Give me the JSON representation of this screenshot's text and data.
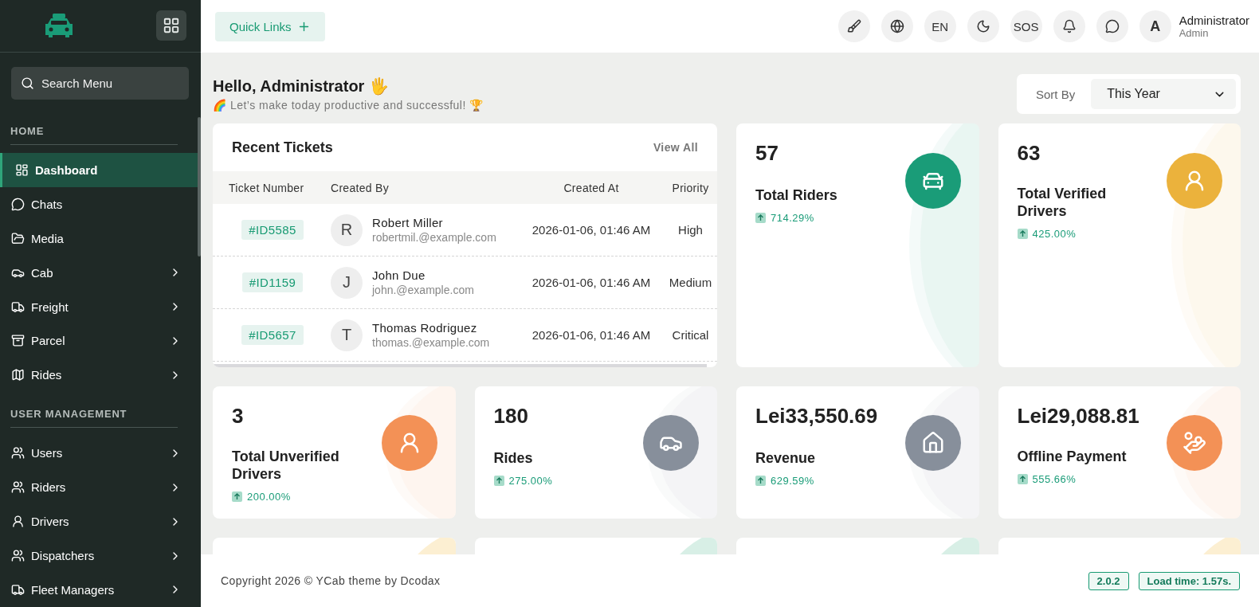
{
  "sidebar": {
    "search": {
      "placeholder": "Search Menu"
    },
    "sections": [
      {
        "title": "HOME",
        "items": [
          {
            "label": "Dashboard",
            "selected": true,
            "expandable": false
          },
          {
            "label": "Chats",
            "selected": false,
            "expandable": false
          },
          {
            "label": "Media",
            "selected": false,
            "expandable": false
          },
          {
            "label": "Cab",
            "selected": false,
            "expandable": true
          },
          {
            "label": "Freight",
            "selected": false,
            "expandable": true
          },
          {
            "label": "Parcel",
            "selected": false,
            "expandable": true
          },
          {
            "label": "Rides",
            "selected": false,
            "expandable": true
          }
        ]
      },
      {
        "title": "USER MANAGEMENT",
        "items": [
          {
            "label": "Users",
            "selected": false,
            "expandable": true
          },
          {
            "label": "Riders",
            "selected": false,
            "expandable": true
          },
          {
            "label": "Drivers",
            "selected": false,
            "expandable": true
          },
          {
            "label": "Dispatchers",
            "selected": false,
            "expandable": true
          },
          {
            "label": "Fleet Managers",
            "selected": false,
            "expandable": true
          }
        ]
      }
    ]
  },
  "header": {
    "quick_links": "Quick Links",
    "language": "EN",
    "sos": "SOS",
    "user": {
      "initial": "A",
      "name": "Administrator",
      "role": "Admin"
    }
  },
  "greeting": {
    "title": "Hello, Administrator 🖐",
    "subtitle": "🌈 Let’s make today productive and successful! 🏆"
  },
  "sort": {
    "label": "Sort By",
    "value": "This Year"
  },
  "recent_tickets": {
    "title": "Recent Tickets",
    "view_all": "View All",
    "columns": [
      "Ticket Number",
      "Created By",
      "Created At",
      "Priority"
    ],
    "rows": [
      {
        "ticket": "#ID5585",
        "initial": "R",
        "name": "Robert Miller",
        "email": "robertmil.@example.com",
        "created_at": "2026-01-06, 01:46 AM",
        "priority": "High"
      },
      {
        "ticket": "#ID1159",
        "initial": "J",
        "name": "John Due",
        "email": "john.@example.com",
        "created_at": "2026-01-06, 01:46 AM",
        "priority": "Medium"
      },
      {
        "ticket": "#ID5657",
        "initial": "T",
        "name": "Thomas Rodriguez",
        "email": "thomas.@example.com",
        "created_at": "2026-01-06, 01:46 AM",
        "priority": "Critical"
      }
    ]
  },
  "stats": [
    {
      "value": "57",
      "label": "Total Riders",
      "change": "714.29%",
      "color": "#1a9c78"
    },
    {
      "value": "63",
      "label": "Total Verified Drivers",
      "change": "425.00%",
      "color": "#ebb23c"
    },
    {
      "value": "3",
      "label": "Total Unverified Drivers",
      "change": "200.00%",
      "color": "#f39156"
    },
    {
      "value": "180",
      "label": "Rides",
      "change": "275.00%",
      "color": "#878f9b"
    },
    {
      "value": "Lei33,550.69",
      "label": "Revenue",
      "change": "629.59%",
      "color": "#878f9b"
    },
    {
      "value": "Lei29,088.81",
      "label": "Offline Payment",
      "change": "555.66%",
      "color": "#f39156"
    }
  ],
  "more_cards": [
    {
      "color": "#fcefd2"
    },
    {
      "color": "#d8efe6"
    },
    {
      "color": "#d8efe6"
    },
    {
      "color": "#fcefd2"
    }
  ],
  "footer": {
    "copyright": "Copyright 2026 © YCab theme by Dcodax",
    "version": "2.0.2",
    "load_time": "Load time: 1.57s."
  }
}
